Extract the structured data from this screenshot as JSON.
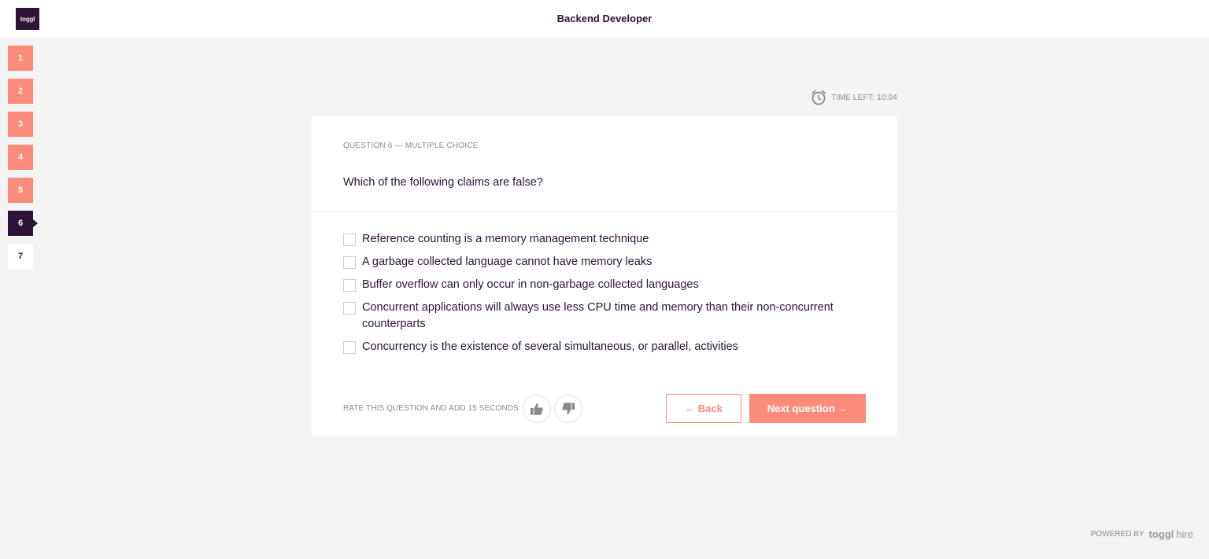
{
  "header": {
    "logo_text": "toggl",
    "title": "Backend Developer"
  },
  "nav": {
    "items": [
      {
        "label": "1",
        "state": "done"
      },
      {
        "label": "2",
        "state": "done"
      },
      {
        "label": "3",
        "state": "done"
      },
      {
        "label": "4",
        "state": "done"
      },
      {
        "label": "5",
        "state": "done"
      },
      {
        "label": "6",
        "state": "active"
      },
      {
        "label": "7",
        "state": "pending"
      }
    ]
  },
  "timer": {
    "icon": "alarm-clock-icon",
    "label": "TIME LEFT: 10:04"
  },
  "question": {
    "type_label": "QUESTION 6 — MULTIPLE CHOICE",
    "text": "Which of the following claims are false?",
    "options": [
      {
        "label": "Reference counting is a memory management technique",
        "checked": false
      },
      {
        "label": "A garbage collected language cannot have memory leaks",
        "checked": false
      },
      {
        "label": "Buffer overflow can only occur in non-garbage collected languages",
        "checked": false
      },
      {
        "label": "Concurrent applications will always use less CPU time and memory than their non-concurrent counterparts",
        "checked": false
      },
      {
        "label": "Concurrency is the existence of several simultaneous, or parallel, activities",
        "checked": false
      }
    ]
  },
  "footer": {
    "rate_label": "RATE THIS QUESTION AND ADD 15 SECONDS:",
    "thumbs_up_icon": "thumbs-up-icon",
    "thumbs_down_icon": "thumbs-down-icon",
    "back_label": "← Back",
    "next_label": "Next question →"
  },
  "powered_by": {
    "label": "POWERED BY",
    "brand": "toggl",
    "brand_suffix": "hire"
  },
  "colors": {
    "accent": "#fd8b7b",
    "dark": "#2c1338",
    "background": "#f4f4f4"
  }
}
